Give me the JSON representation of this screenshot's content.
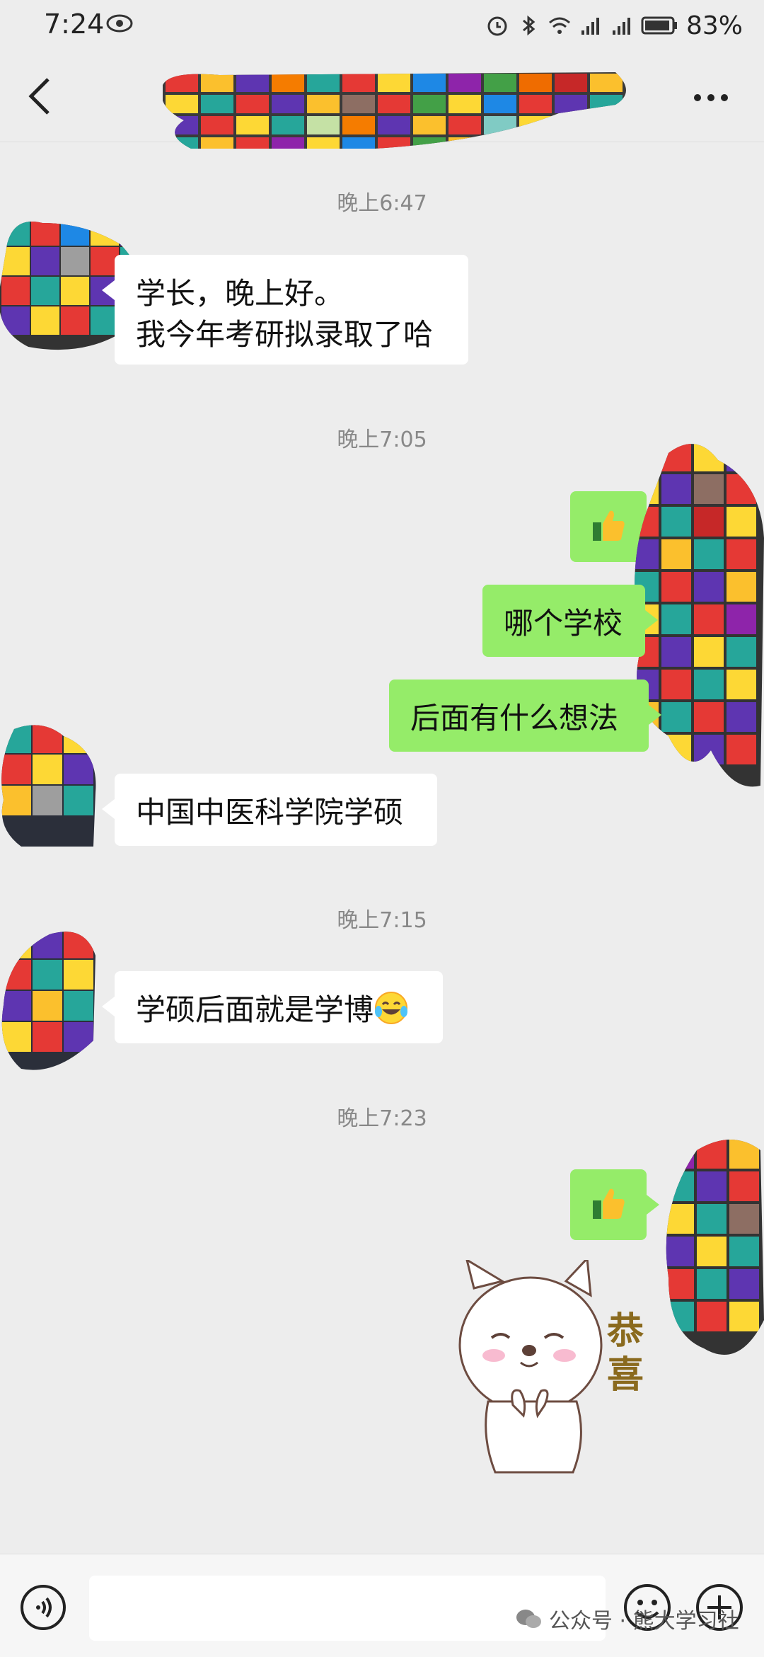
{
  "status_bar": {
    "time": "7:24",
    "battery": "83%"
  },
  "header": {
    "title": "",
    "more_label": "..."
  },
  "messages": {
    "ts1": "晚上6:47",
    "m1_line1": "学长，晚上好。",
    "m1_line2": "我今年考研拟录取了哈",
    "ts2": "晚上7:05",
    "m3": "哪个学校",
    "m4": "后面有什么想法",
    "m5": "中国中医科学院学硕",
    "ts3": "晚上7:15",
    "m6": "学硕后面就是学博",
    "ts4": "晚上7:23",
    "sticker_text": "恭喜"
  },
  "input_bar": {
    "placeholder": ""
  },
  "watermark": {
    "text": "公众号 · 熊大学习社"
  },
  "colors": {
    "accent_green": "#95ec69",
    "background": "#ededed"
  }
}
